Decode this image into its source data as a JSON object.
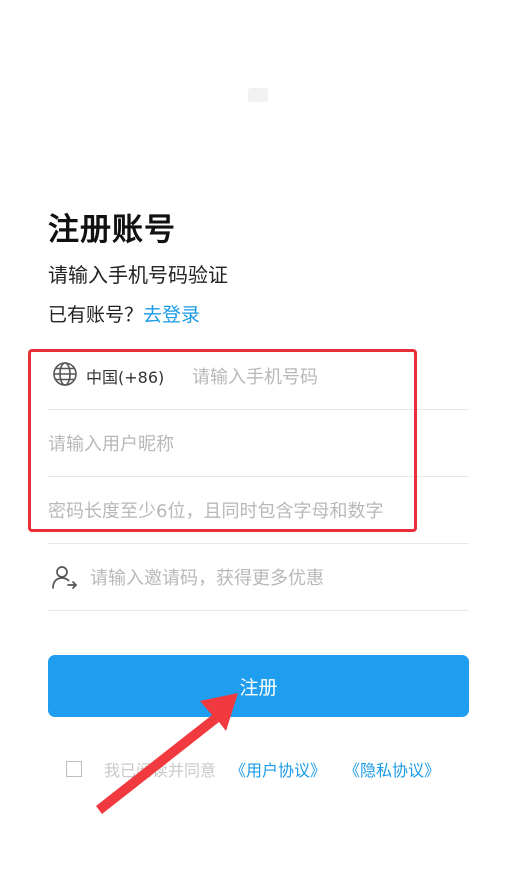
{
  "header": {
    "title": "注册账号",
    "subtitle": "请输入手机号码验证",
    "has_account": "已有账号？",
    "login_link": "去登录"
  },
  "form": {
    "country_code": "中国(+86)",
    "phone_placeholder": "请输入手机号码",
    "nickname_placeholder": "请输入用户昵称",
    "password_placeholder": "密码长度至少6位，且同时包含字母和数字",
    "invite_placeholder": "请输入邀请码，获得更多优惠"
  },
  "register_button": "注册",
  "agreement": {
    "text": "我已阅读并同意",
    "user_agreement": "《用户协议》",
    "privacy_agreement": "《隐私协议》",
    "checked": false
  },
  "annotation": {
    "highlight_color": "#e8303a",
    "arrow_color": "#f03a3f"
  },
  "icons": [
    "globe-icon",
    "user-add-icon"
  ],
  "colors": {
    "accent": "#1f9ef0",
    "link": "#1a9be8"
  }
}
